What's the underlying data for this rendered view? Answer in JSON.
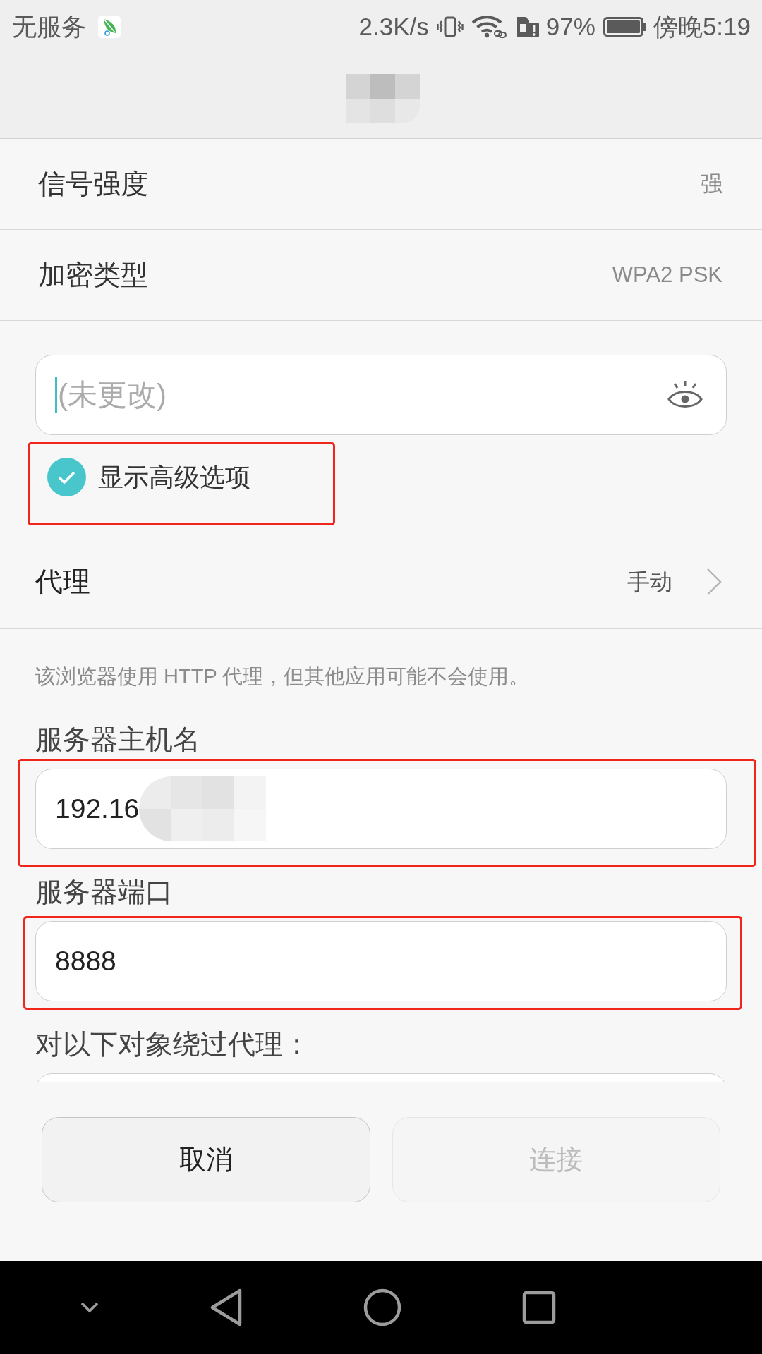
{
  "status_bar": {
    "carrier": "无服务",
    "speed": "2.3K/s",
    "battery": "97%",
    "time": "傍晚5:19"
  },
  "info_rows": [
    {
      "label": "信号强度",
      "value": "强"
    },
    {
      "label": "加密类型",
      "value": "WPA2 PSK"
    }
  ],
  "password": {
    "placeholder": "(未更改)",
    "focused": true
  },
  "advanced_options": {
    "label": "显示高级选项",
    "checked": true,
    "highlighted": true
  },
  "proxy": {
    "label": "代理",
    "value": "手动"
  },
  "proxy_note": "该浏览器使用 HTTP 代理，但其他应用可能不会使用。",
  "proxy_fields": [
    {
      "label": "服务器主机名",
      "value": "192.16",
      "redacted": true,
      "highlighted": true
    },
    {
      "label": "服务器端口",
      "value": "8888",
      "redacted": false,
      "highlighted": true
    },
    {
      "label": "对以下对象绕过代理：",
      "redacted": false,
      "highlighted": false
    }
  ],
  "buttons": [
    {
      "label": "取消",
      "disabled": false
    },
    {
      "label": "连接",
      "disabled": true
    }
  ]
}
